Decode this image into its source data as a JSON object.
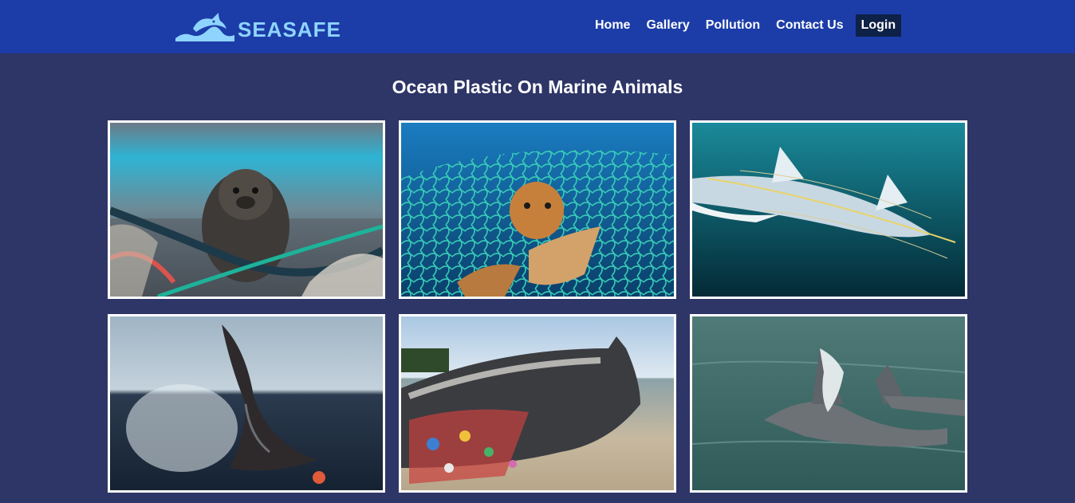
{
  "brand": {
    "name": "SEASAFE"
  },
  "nav": {
    "links": [
      {
        "label": "Home"
      },
      {
        "label": "Gallery"
      },
      {
        "label": "Pollution"
      },
      {
        "label": "Contact Us"
      },
      {
        "label": "Login"
      }
    ]
  },
  "main": {
    "title": "Ocean Plastic On Marine Animals"
  },
  "colors": {
    "navbar": "#1c3da8",
    "background": "#2e3567",
    "logo": "#8fd4ff",
    "login_bg": "#0e2146"
  }
}
